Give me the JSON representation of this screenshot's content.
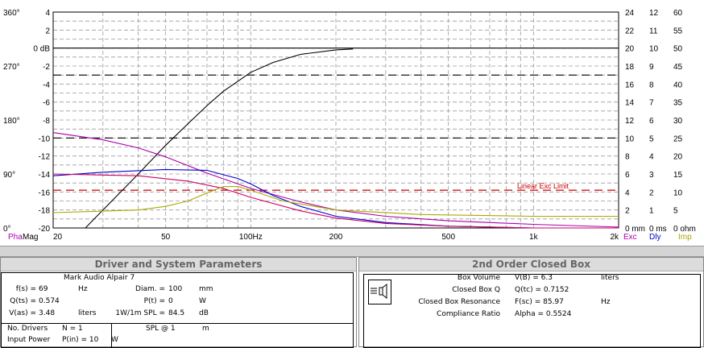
{
  "chart_data": {
    "type": "line",
    "x_axis": {
      "scale": "log",
      "range": [
        20,
        2000
      ],
      "tick_labels": [
        {
          "value": 20,
          "label": "20"
        },
        {
          "value": 50,
          "label": "50"
        },
        {
          "value": 100,
          "label": "100Hz"
        },
        {
          "value": 200,
          "label": "200"
        },
        {
          "value": 500,
          "label": "500"
        },
        {
          "value": 1000,
          "label": "1k"
        },
        {
          "value": 2000,
          "label": "2k"
        }
      ],
      "corner_labels": {
        "phase": "Pha",
        "mag": "Mag",
        "exc": "Exc",
        "dly": "Dly",
        "imp": "Imp"
      }
    },
    "left_phase_ticks": [
      {
        "label": "360°",
        "db": 4
      },
      {
        "label": "270°",
        "db": -2
      },
      {
        "label": "180°",
        "db": -8
      },
      {
        "label": "90°",
        "db": -14
      },
      {
        "label": "0°",
        "db": -20
      }
    ],
    "mag_ticks": [
      {
        "label": "4",
        "db": 4
      },
      {
        "label": "2",
        "db": 2
      },
      {
        "label": "0 dB",
        "db": 0
      },
      {
        "label": "-2",
        "db": -2
      },
      {
        "label": "-4",
        "db": -4
      },
      {
        "label": "-6",
        "db": -6
      },
      {
        "label": "-8",
        "db": -8
      },
      {
        "label": "-10",
        "db": -10
      },
      {
        "label": "-12",
        "db": -12
      },
      {
        "label": "-14",
        "db": -14
      },
      {
        "label": "-16",
        "db": -16
      },
      {
        "label": "-18",
        "db": -18
      },
      {
        "label": "-20",
        "db": -20
      }
    ],
    "right_columns": [
      {
        "name": "exc",
        "labels": [
          "24",
          "22",
          "20",
          "18",
          "16",
          "14",
          "12",
          "10",
          "8",
          "6",
          "4",
          "2",
          "0 mm"
        ]
      },
      {
        "name": "dly",
        "labels": [
          "12",
          "11",
          "10",
          "9",
          "8",
          "7",
          "6",
          "5",
          "4",
          "3",
          "2",
          "1",
          "0 ms"
        ]
      },
      {
        "name": "imp",
        "labels": [
          "60",
          "55",
          "50",
          "45",
          "40",
          "35",
          "30",
          "25",
          "20",
          "15",
          "10",
          "5",
          "0 ohm"
        ]
      }
    ],
    "reference_lines": [
      {
        "db": 0,
        "style": "solid",
        "color": "#000000"
      },
      {
        "db": -3,
        "style": "dash",
        "color": "#000000"
      },
      {
        "db": -10,
        "style": "dash",
        "color": "#000000"
      },
      {
        "db": -15.8,
        "style": "dash",
        "color": "#cc0000",
        "label": "Linear Exc Limit"
      }
    ],
    "series": [
      {
        "color": "#000000",
        "points": [
          [
            26,
            -20
          ],
          [
            30,
            -18
          ],
          [
            40,
            -14
          ],
          [
            50,
            -10.8
          ],
          [
            60,
            -8.4
          ],
          [
            70,
            -6.4
          ],
          [
            80,
            -4.8
          ],
          [
            100,
            -2.7
          ],
          [
            120,
            -1.6
          ],
          [
            150,
            -0.7
          ],
          [
            200,
            -0.2
          ],
          [
            230,
            -0.1
          ]
        ]
      },
      {
        "color": "#aa00aa",
        "points": [
          [
            20,
            -9.4
          ],
          [
            30,
            -10.2
          ],
          [
            40,
            -11.1
          ],
          [
            50,
            -12.1
          ],
          [
            70,
            -13.9
          ],
          [
            100,
            -15.6
          ],
          [
            150,
            -17.1
          ],
          [
            200,
            -18.0
          ],
          [
            300,
            -18.7
          ],
          [
            500,
            -19.2
          ],
          [
            1000,
            -19.6
          ],
          [
            2000,
            -19.9
          ]
        ]
      },
      {
        "color": "#0000cc",
        "points": [
          [
            20,
            -14.2
          ],
          [
            30,
            -13.8
          ],
          [
            50,
            -13.5
          ],
          [
            70,
            -13.6
          ],
          [
            90,
            -14.5
          ],
          [
            100,
            -15.1
          ],
          [
            120,
            -16.4
          ],
          [
            150,
            -17.6
          ],
          [
            200,
            -18.7
          ],
          [
            300,
            -19.4
          ],
          [
            500,
            -19.8
          ],
          [
            1000,
            -20
          ],
          [
            2000,
            -20
          ]
        ]
      },
      {
        "color": "#cc0066",
        "points": [
          [
            20,
            -14.0
          ],
          [
            40,
            -14.2
          ],
          [
            60,
            -14.8
          ],
          [
            80,
            -15.6
          ],
          [
            100,
            -16.6
          ],
          [
            150,
            -18.1
          ],
          [
            200,
            -18.9
          ],
          [
            300,
            -19.5
          ],
          [
            500,
            -19.8
          ],
          [
            1000,
            -20
          ],
          [
            2000,
            -20
          ]
        ]
      },
      {
        "color": "#aaaa00",
        "points": [
          [
            20,
            -18.3
          ],
          [
            40,
            -18.0
          ],
          [
            50,
            -17.6
          ],
          [
            60,
            -17.0
          ],
          [
            70,
            -16.1
          ],
          [
            80,
            -15.4
          ],
          [
            90,
            -15.4
          ],
          [
            100,
            -15.8
          ],
          [
            130,
            -17.0
          ],
          [
            200,
            -18.0
          ],
          [
            400,
            -18.5
          ],
          [
            1000,
            -18.7
          ],
          [
            2000,
            -18.7
          ]
        ]
      }
    ]
  },
  "driver_panel": {
    "title": "Driver and System Parameters",
    "driver_name": "Mark Audio  Alpair 7",
    "fs_label": "f(s) =",
    "fs_value": "69",
    "fs_unit": "Hz",
    "qts_label": "Q(ts) =",
    "qts_value": "0.574",
    "vas_label": "V(as) =",
    "vas_value": "3.48",
    "vas_unit": "liters",
    "diam_label": "Diam. =",
    "diam_value": "100",
    "diam_unit": "mm",
    "pt_label": "P(t) =",
    "pt_value": "0",
    "pt_unit": "W",
    "spl_label": "1W/1m SPL =",
    "spl_value": "84.5",
    "spl_unit": "dB",
    "drivers_label": "No. Drivers",
    "drivers_n": "N = 1",
    "power_label": "Input Power",
    "power_field": "P(in) = 10",
    "power_unit": "W",
    "splat_label": "SPL @ 1",
    "splat_unit": "m"
  },
  "box_panel": {
    "title": "2nd Order Closed Box",
    "rows": [
      {
        "label": "Box Volume",
        "value": "V(B) = 6.3",
        "unit": "liters"
      },
      {
        "label": "Closed Box Q",
        "value": "Q(tc) = 0.7152",
        "unit": ""
      },
      {
        "label": "Closed Box Resonance",
        "value": "F(sc) = 85.97",
        "unit": "Hz"
      },
      {
        "label": "Compliance Ratio",
        "value": "Alpha = 0.5524",
        "unit": ""
      }
    ]
  }
}
